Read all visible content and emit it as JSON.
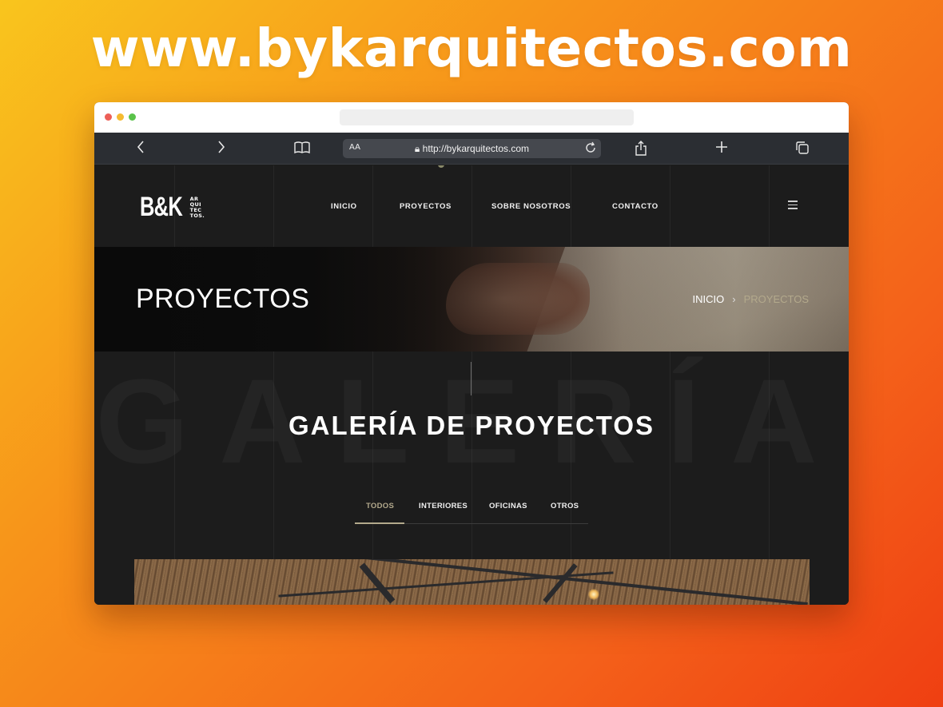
{
  "promo": {
    "headline": "www.bykarquitectos.com"
  },
  "browser": {
    "reader_label": "AA",
    "url": "http://bykarquitectos.com"
  },
  "site": {
    "logo": {
      "main": "B&K",
      "sub_lines": [
        "AR",
        "QUI",
        "TEC",
        "TOS."
      ]
    },
    "nav": {
      "items": [
        {
          "label": "INICIO"
        },
        {
          "label": "PROYECTOS"
        },
        {
          "label": "SOBRE NOSOTROS"
        },
        {
          "label": "CONTACTO"
        }
      ]
    },
    "hero": {
      "title": "PROYECTOS",
      "breadcrumb": {
        "home": "INICIO",
        "separator": "›",
        "current": "PROYECTOS"
      }
    },
    "gallery": {
      "background_word": "GALERÍA",
      "title": "GALERÍA DE PROYECTOS",
      "tabs": [
        {
          "label": "TODOS",
          "active": true
        },
        {
          "label": "INTERIORES",
          "active": false
        },
        {
          "label": "OFICINAS",
          "active": false
        },
        {
          "label": "OTROS",
          "active": false
        }
      ]
    }
  },
  "colors": {
    "accent": "#b3a98c",
    "site_bg": "#1c1c1c"
  }
}
